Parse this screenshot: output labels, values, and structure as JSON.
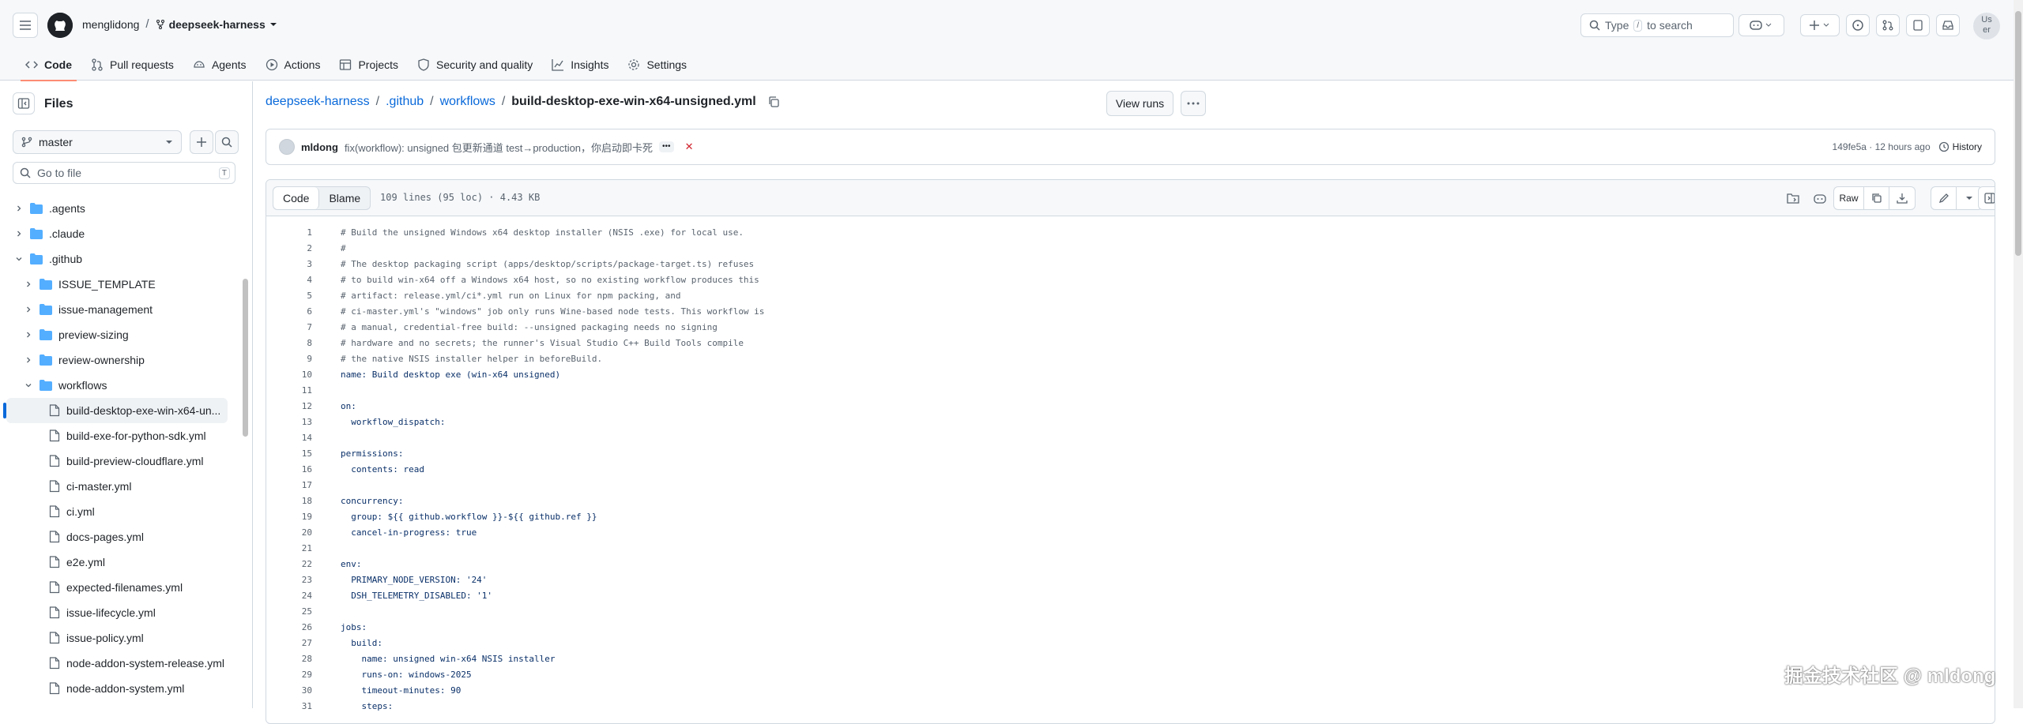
{
  "header": {
    "owner": "menglidong",
    "separator": "/",
    "repo": "deepseek-harness",
    "search_type": "Type",
    "search_key": "/",
    "search_rest": "to search",
    "avatar_text": "Us\ner"
  },
  "tabs": [
    {
      "label": "Code",
      "icon": "code-icon"
    },
    {
      "label": "Pull requests",
      "icon": "git-pull-request-icon"
    },
    {
      "label": "Agents",
      "icon": "agent-icon"
    },
    {
      "label": "Actions",
      "icon": "play-icon"
    },
    {
      "label": "Projects",
      "icon": "table-icon"
    },
    {
      "label": "Security and quality",
      "icon": "shield-icon"
    },
    {
      "label": "Insights",
      "icon": "graph-icon"
    },
    {
      "label": "Settings",
      "icon": "gear-icon"
    }
  ],
  "sidebar": {
    "title": "Files",
    "branch": "master",
    "goto_placeholder": "Go to file",
    "goto_key": "T",
    "tree": [
      {
        "label": ".agents",
        "type": "folder",
        "depth": 0,
        "open": false
      },
      {
        "label": ".claude",
        "type": "folder",
        "depth": 0,
        "open": false
      },
      {
        "label": ".github",
        "type": "folder",
        "depth": 0,
        "open": true
      },
      {
        "label": "ISSUE_TEMPLATE",
        "type": "folder",
        "depth": 1,
        "open": false
      },
      {
        "label": "issue-management",
        "type": "folder",
        "depth": 1,
        "open": false
      },
      {
        "label": "preview-sizing",
        "type": "folder",
        "depth": 1,
        "open": false
      },
      {
        "label": "review-ownership",
        "type": "folder",
        "depth": 1,
        "open": false
      },
      {
        "label": "workflows",
        "type": "folder",
        "depth": 1,
        "open": true
      },
      {
        "label": "build-desktop-exe-win-x64-un...",
        "type": "file",
        "depth": 2,
        "selected": true
      },
      {
        "label": "build-exe-for-python-sdk.yml",
        "type": "file",
        "depth": 2
      },
      {
        "label": "build-preview-cloudflare.yml",
        "type": "file",
        "depth": 2
      },
      {
        "label": "ci-master.yml",
        "type": "file",
        "depth": 2
      },
      {
        "label": "ci.yml",
        "type": "file",
        "depth": 2
      },
      {
        "label": "docs-pages.yml",
        "type": "file",
        "depth": 2
      },
      {
        "label": "e2e.yml",
        "type": "file",
        "depth": 2
      },
      {
        "label": "expected-filenames.yml",
        "type": "file",
        "depth": 2
      },
      {
        "label": "issue-lifecycle.yml",
        "type": "file",
        "depth": 2
      },
      {
        "label": "issue-policy.yml",
        "type": "file",
        "depth": 2
      },
      {
        "label": "node-addon-system-release.yml",
        "type": "file",
        "depth": 2
      },
      {
        "label": "node-addon-system.yml",
        "type": "file",
        "depth": 2
      }
    ]
  },
  "breadcrumb": {
    "parts": [
      "deepseek-harness",
      ".github",
      "workflows"
    ],
    "current": "build-desktop-exe-win-x64-unsigned.yml",
    "sep": "/"
  },
  "view_runs": "View runs",
  "commit": {
    "user": "mldong",
    "message": "fix(workflow): unsigned 包更新通道 test→production，你启动即卡死",
    "dots": "•••",
    "status": "✕",
    "sha_time": "149fe5a · 12 hours ago",
    "history": "History"
  },
  "viewer": {
    "tab_code": "Code",
    "tab_blame": "Blame",
    "meta": "109 lines (95 loc) · 4.43 KB",
    "raw": "Raw"
  },
  "code_lines": [
    "# Build the unsigned Windows x64 desktop installer (NSIS .exe) for local use.",
    "#",
    "# The desktop packaging script (apps/desktop/scripts/package-target.ts) refuses",
    "# to build win-x64 off a Windows x64 host, so no existing workflow produces this",
    "# artifact: release.yml/ci*.yml run on Linux for npm packing, and",
    "# ci-master.yml's \"windows\" job only runs Wine-based node tests. This workflow is",
    "# a manual, credential-free build: --unsigned packaging needs no signing",
    "# hardware and no secrets; the runner's Visual Studio C++ Build Tools compile",
    "# the native NSIS installer helper in beforeBuild.",
    "name: Build desktop exe (win-x64 unsigned)",
    "",
    "on:",
    "  workflow_dispatch:",
    "",
    "permissions:",
    "  contents: read",
    "",
    "concurrency:",
    "  group: ${{ github.workflow }}-${{ github.ref }}",
    "  cancel-in-progress: true",
    "",
    "env:",
    "  PRIMARY_NODE_VERSION: '24'",
    "  DSH_TELEMETRY_DISABLED: '1'",
    "",
    "jobs:",
    "  build:",
    "    name: unsigned win-x64 NSIS installer",
    "    runs-on: windows-2025",
    "    timeout-minutes: 90",
    "    steps:"
  ],
  "watermark": "掘金技术社区 @ mldong",
  "colors": {
    "accent": "#0969da",
    "tab_underline": "#fd8c73",
    "folder": "#54aeff"
  }
}
